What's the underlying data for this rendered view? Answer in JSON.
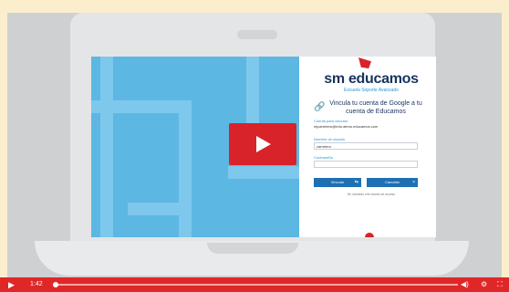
{
  "brand": {
    "name": "sm educamos",
    "subtitle": "Escuela Soporte Avanzado",
    "accent": "#d8232a",
    "navy": "#17345e",
    "blue": "#1e9ad7"
  },
  "login": {
    "link_title": "Vincula tu cuenta de Google a tu cuenta de Educamos",
    "account_label": "Cuenta para vincular:",
    "account_email": "mjcarretero@edu.demo.educamos.com",
    "username_label": "Nombre de usuario",
    "username_value": "carretero",
    "password_label": "Contraseña",
    "password_value": "",
    "link_button": "Vincular",
    "cancel_button": "Cancelar",
    "forgot_text": "He olvidado mis claves de acceso"
  },
  "player": {
    "time": "1:42",
    "progress_fraction": 0.0,
    "play_icon": "play-icon",
    "volume_icon": "volume-icon",
    "settings_icon": "gear-icon",
    "fullscreen_icon": "fullscreen-icon",
    "controls_color": "#e02727"
  }
}
